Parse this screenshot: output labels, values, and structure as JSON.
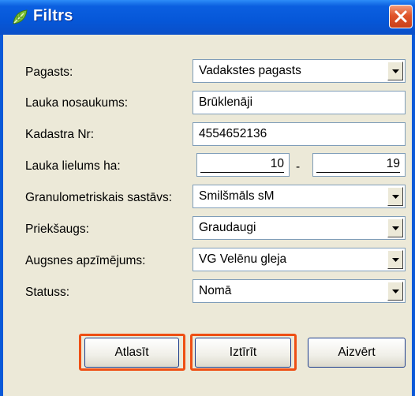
{
  "window": {
    "title": "Filtrs",
    "title_icon": "leaf-icon",
    "close_icon": "close-icon"
  },
  "fields": {
    "pagasts": {
      "label": "Pagasts:",
      "value": "Vadakstes pagasts"
    },
    "lauka_nosaukums": {
      "label": "Lauka nosaukums:",
      "value": "Brūklenāji"
    },
    "kadastra_nr": {
      "label": "Kadastra Nr:",
      "value": "4554652136"
    },
    "lauka_lielums": {
      "label": "Lauka lielums ha:",
      "from": "10",
      "separator": "-",
      "to": "19"
    },
    "granulometriskais": {
      "label": "Granulometriskais sastāvs:",
      "value": "Smilšmāls sM"
    },
    "prieksaugs": {
      "label": "Priekšaugs:",
      "value": "Graudaugi"
    },
    "augsnes": {
      "label": "Augsnes apzīmējums:",
      "value": "VG Velēnu gleja"
    },
    "statuss": {
      "label": "Statuss:",
      "value": "Nomā"
    }
  },
  "buttons": {
    "atlasit": "Atlasīt",
    "iztirit": "Iztīrīt",
    "aizvert": "Aizvērt"
  },
  "colors": {
    "titlebar": "#0657d8",
    "dialog_bg": "#ece9d8",
    "highlight": "#ee4f14",
    "close_button": "#e0542a"
  }
}
